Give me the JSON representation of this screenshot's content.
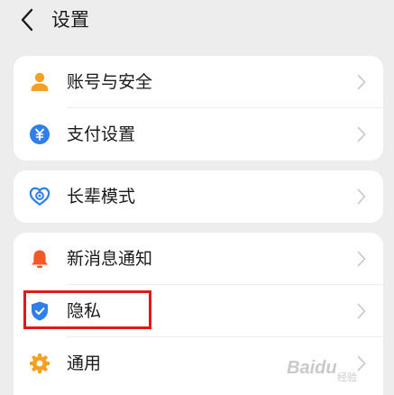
{
  "header": {
    "title": "设置"
  },
  "groups": [
    {
      "items": [
        {
          "label": "账号与安全",
          "icon": "person-icon"
        },
        {
          "label": "支付设置",
          "icon": "payment-icon"
        }
      ]
    },
    {
      "items": [
        {
          "label": "长辈模式",
          "icon": "heart-care-icon"
        }
      ]
    },
    {
      "items": [
        {
          "label": "新消息通知",
          "icon": "bell-icon"
        },
        {
          "label": "隐私",
          "icon": "shield-icon"
        },
        {
          "label": "通用",
          "icon": "gear-icon"
        }
      ]
    }
  ],
  "watermark": {
    "text": "Baidu",
    "sub": "经验"
  },
  "colors": {
    "orange": "#f5a025",
    "blue": "#2f7fe8",
    "bell": "#f05a28",
    "highlight": "#e01a1a",
    "background": "#ededed"
  }
}
